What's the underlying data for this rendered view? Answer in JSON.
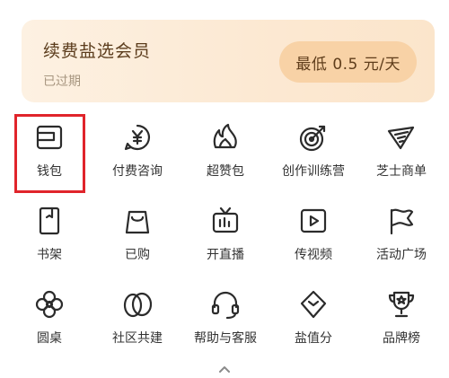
{
  "vip_card": {
    "title": "续费盐选会员",
    "status": "已过期",
    "price": "最低 0.5 元/天"
  },
  "grid": {
    "rows": [
      [
        {
          "label": "钱包",
          "icon": "wallet-icon"
        },
        {
          "label": "付费咨询",
          "icon": "yen-chat-icon"
        },
        {
          "label": "超赞包",
          "icon": "flame-icon"
        },
        {
          "label": "创作训练营",
          "icon": "target-icon"
        },
        {
          "label": "芝士商单",
          "icon": "cheese-icon"
        }
      ],
      [
        {
          "label": "书架",
          "icon": "bookshelf-icon"
        },
        {
          "label": "已购",
          "icon": "shopping-bag-icon"
        },
        {
          "label": "开直播",
          "icon": "live-tv-icon"
        },
        {
          "label": "传视频",
          "icon": "video-play-icon"
        },
        {
          "label": "活动广场",
          "icon": "flag-icon"
        }
      ],
      [
        {
          "label": "圆桌",
          "icon": "flower-icon"
        },
        {
          "label": "社区共建",
          "icon": "overlap-circles-icon"
        },
        {
          "label": "帮助与客服",
          "icon": "headset-icon"
        },
        {
          "label": "盐值分",
          "icon": "diamond-icon"
        },
        {
          "label": "品牌榜",
          "icon": "trophy-icon"
        }
      ]
    ]
  },
  "colors": {
    "accent_highlight": "#e0242b",
    "vip_text": "#5b3c1c",
    "vip_pill": "#f8d2a6"
  },
  "collapse_icon": "chevron-up-icon"
}
